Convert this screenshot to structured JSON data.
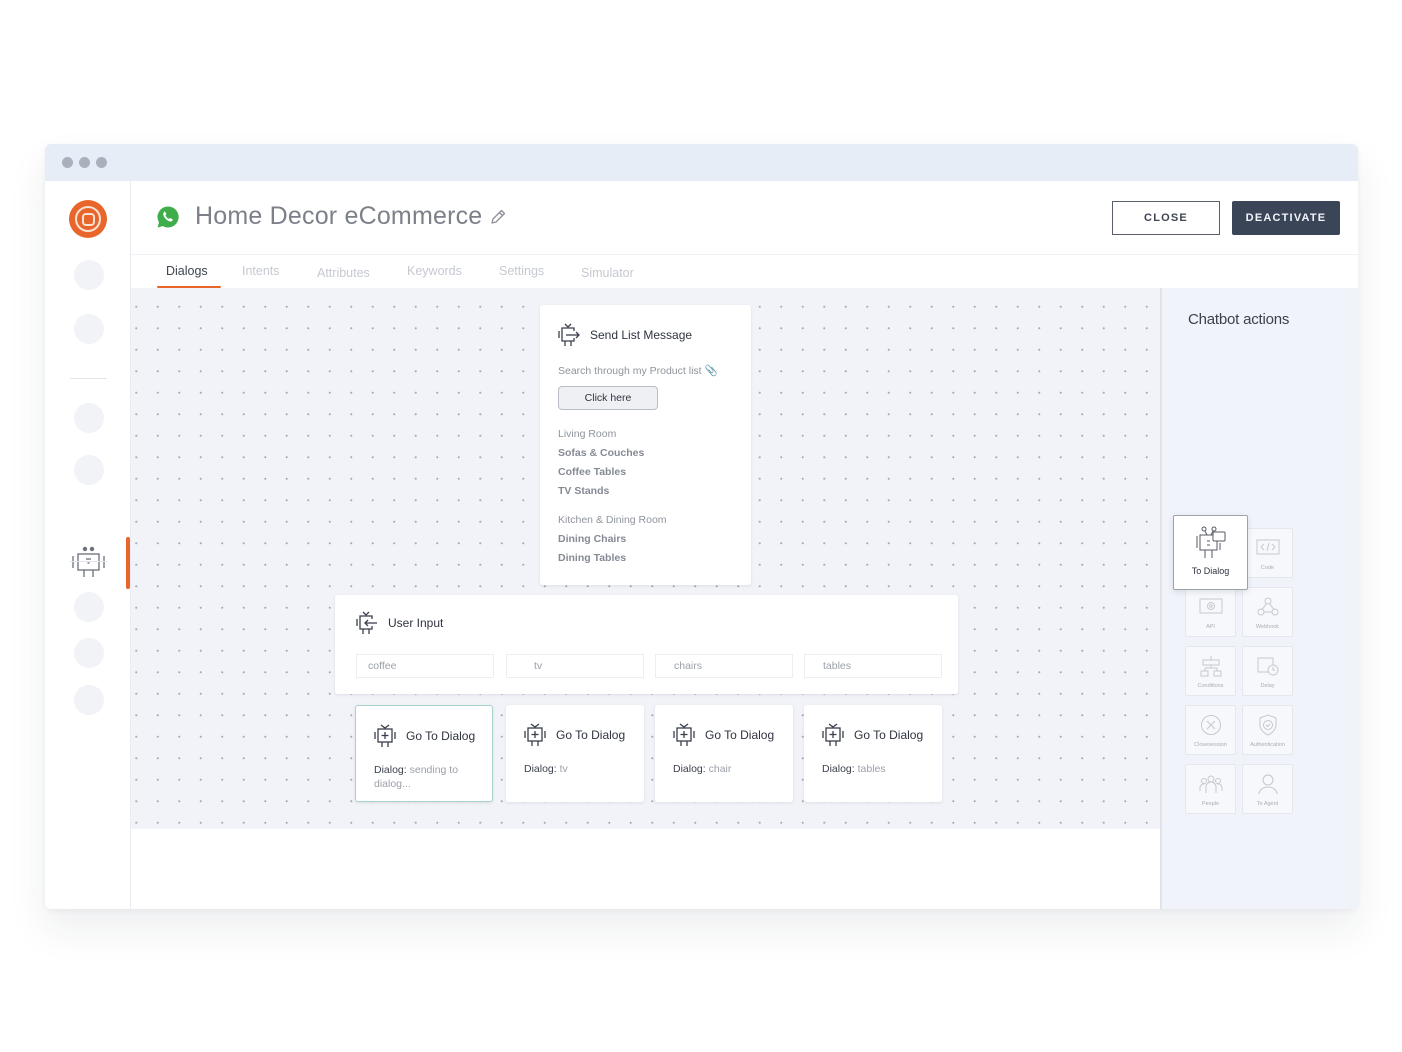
{
  "window": {
    "title_dots": 3
  },
  "header": {
    "title": "Home Decor eCommerce",
    "channel_icon": "whatsapp-icon",
    "edit_icon": "pencil-icon",
    "close_label": "CLOSE",
    "deactivate_label": "DEACTIVATE"
  },
  "sidebar": {
    "logo": "brand-logo",
    "active_item": "chatbot-icon"
  },
  "tabs": [
    {
      "label": "Dialogs",
      "active": true
    },
    {
      "label": "Intents",
      "active": false
    },
    {
      "label": "Attributes",
      "active": false
    },
    {
      "label": "Keywords",
      "active": false
    },
    {
      "label": "Settings",
      "active": false
    },
    {
      "label": "Simulator",
      "active": false
    }
  ],
  "canvas": {
    "send_list": {
      "title": "Send List Message",
      "description": "Search through my Product list 📎",
      "button_label": "Click here",
      "sections": [
        {
          "heading": "Living Room",
          "items": [
            "Sofas & Couches",
            "Coffee Tables",
            "TV Stands"
          ]
        },
        {
          "heading": "Kitchen & Dining Room",
          "items": [
            "Dining Chairs",
            "Dining Tables"
          ]
        }
      ]
    },
    "user_input": {
      "title": "User Input",
      "fields": [
        "coffee",
        "tv",
        "chairs",
        "tables"
      ]
    },
    "go_to_dialogs": [
      {
        "title": "Go To Dialog",
        "label": "Dialog:",
        "value": "sending to dialog...",
        "selected": true
      },
      {
        "title": "Go To Dialog",
        "label": "Dialog:",
        "value": "tv",
        "selected": false
      },
      {
        "title": "Go To Dialog",
        "label": "Dialog:",
        "value": "chair",
        "selected": false
      },
      {
        "title": "Go To Dialog",
        "label": "Dialog:",
        "value": "tables",
        "selected": false
      }
    ]
  },
  "actions_panel": {
    "title": "Chatbot actions",
    "actions": [
      {
        "label": "To Dialog",
        "icon": "to-dialog-icon",
        "featured": true
      },
      {
        "label": "Code",
        "icon": "code-icon"
      },
      {
        "label": "API",
        "icon": "api-icon"
      },
      {
        "label": "Webhook",
        "icon": "webhook-icon"
      },
      {
        "label": "Conditions",
        "icon": "conditions-icon"
      },
      {
        "label": "Delay",
        "icon": "delay-icon"
      },
      {
        "label": "Closesession",
        "icon": "close-session-icon"
      },
      {
        "label": "Authentication",
        "icon": "authentication-icon"
      },
      {
        "label": "People",
        "icon": "people-icon"
      },
      {
        "label": "To Agent",
        "icon": "to-agent-icon"
      }
    ]
  }
}
